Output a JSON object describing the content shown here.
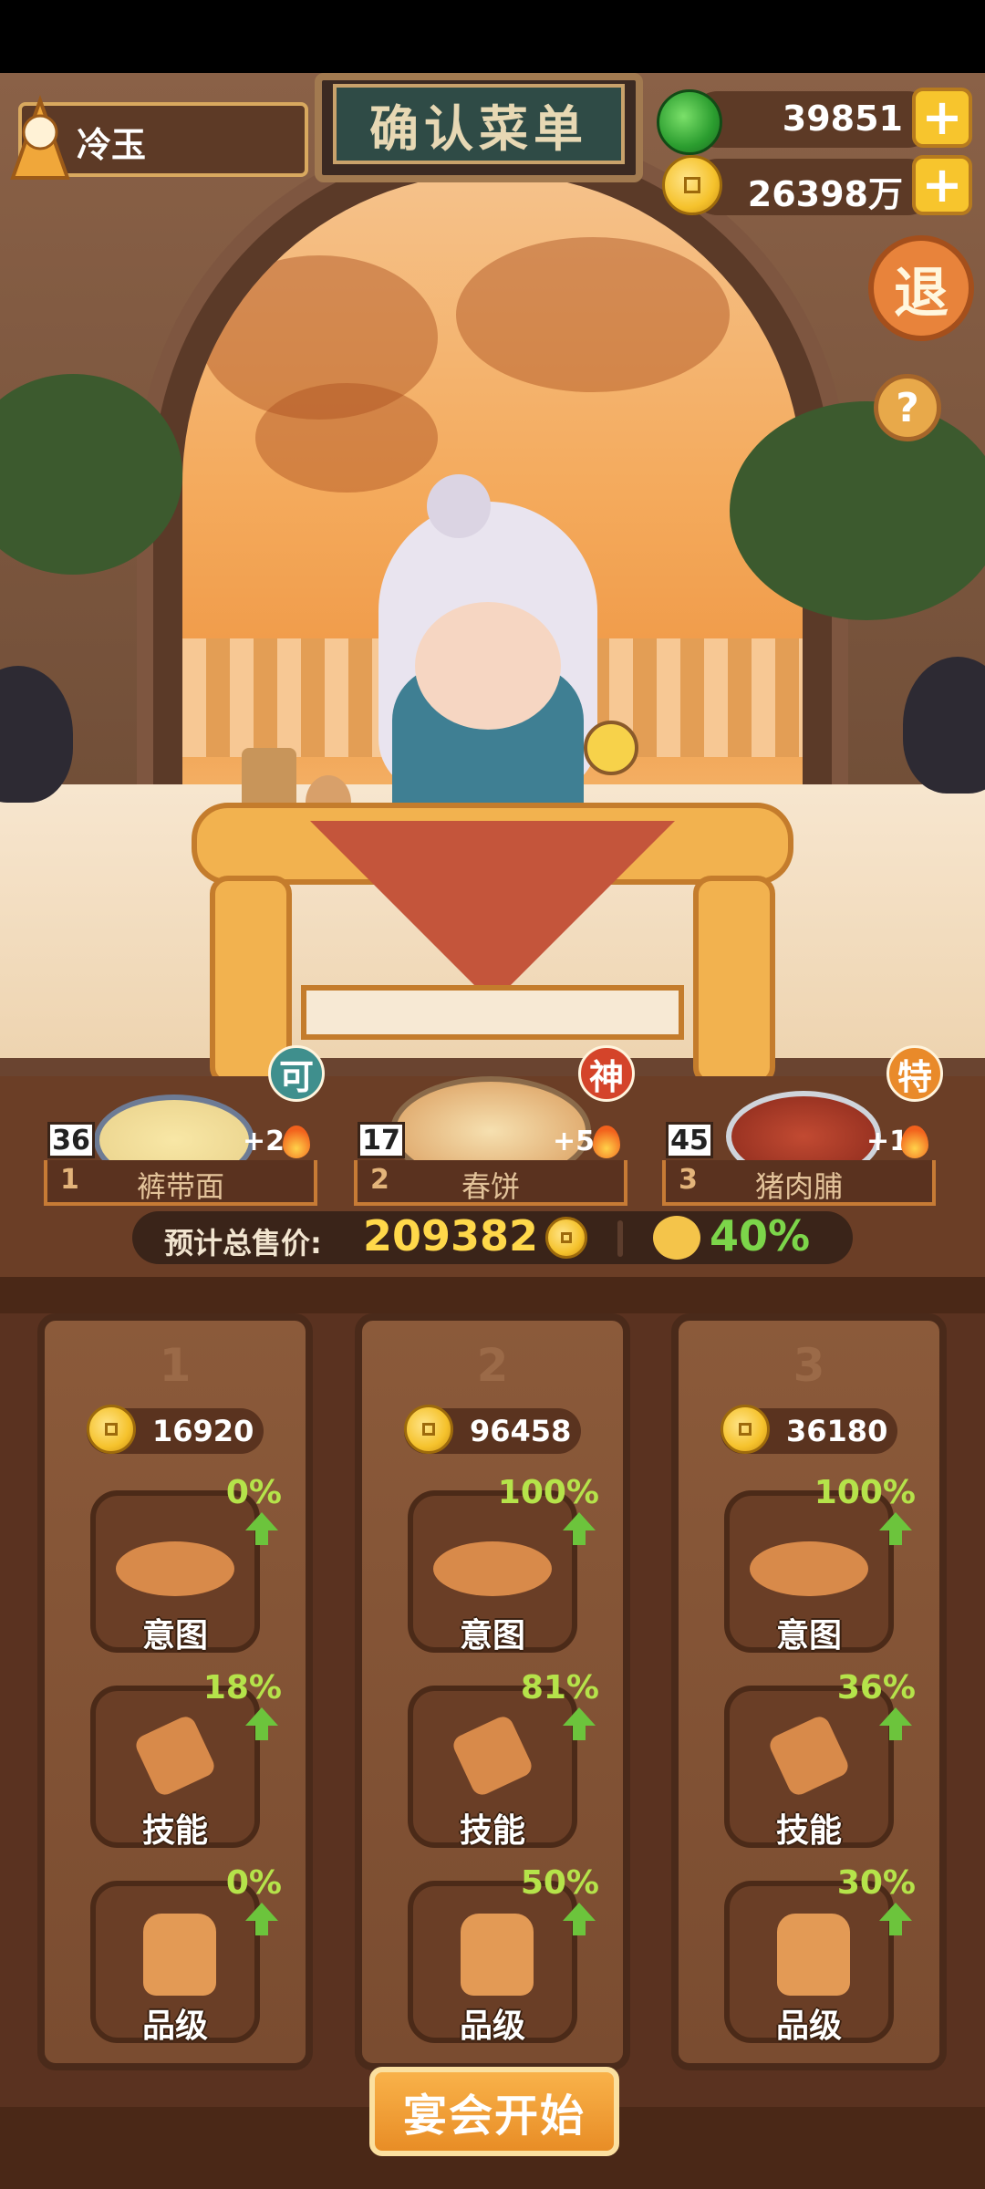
{
  "header": {
    "player_name": "冷玉",
    "title": "确认菜单",
    "jade_amount": "39851",
    "coin_amount": "26398万",
    "exit_label": "退",
    "help_label": "?"
  },
  "dishes": [
    {
      "index": "1",
      "name": "裤带面",
      "level": "36",
      "bonus": "+2",
      "badge": "可",
      "badge_color": "#3f8f8d"
    },
    {
      "index": "2",
      "name": "春饼",
      "level": "17",
      "bonus": "+5",
      "badge": "神",
      "badge_color": "#d4442a"
    },
    {
      "index": "3",
      "name": "猪肉脯",
      "level": "45",
      "bonus": "+1",
      "badge": "特",
      "badge_color": "#e98a2a"
    }
  ],
  "summary": {
    "price_label": "预计总售价:",
    "price_value": "209382",
    "bonus_percent": "40%"
  },
  "columns": [
    {
      "number": "1",
      "cost": "16920",
      "upgrades": [
        {
          "label": "意图",
          "percent": "0%"
        },
        {
          "label": "技能",
          "percent": "18%"
        },
        {
          "label": "品级",
          "percent": "0%"
        }
      ]
    },
    {
      "number": "2",
      "cost": "96458",
      "upgrades": [
        {
          "label": "意图",
          "percent": "100%"
        },
        {
          "label": "技能",
          "percent": "81%"
        },
        {
          "label": "品级",
          "percent": "50%"
        }
      ]
    },
    {
      "number": "3",
      "cost": "36180",
      "upgrades": [
        {
          "label": "意图",
          "percent": "100%"
        },
        {
          "label": "技能",
          "percent": "36%"
        },
        {
          "label": "品级",
          "percent": "30%"
        }
      ]
    }
  ],
  "start_button": "宴会开始",
  "colors": {
    "jade_green": "#2b9d2f",
    "coin_gold": "#f5c22c",
    "percent_green": "#b5e34a",
    "bonus_green": "#7cd54a"
  }
}
